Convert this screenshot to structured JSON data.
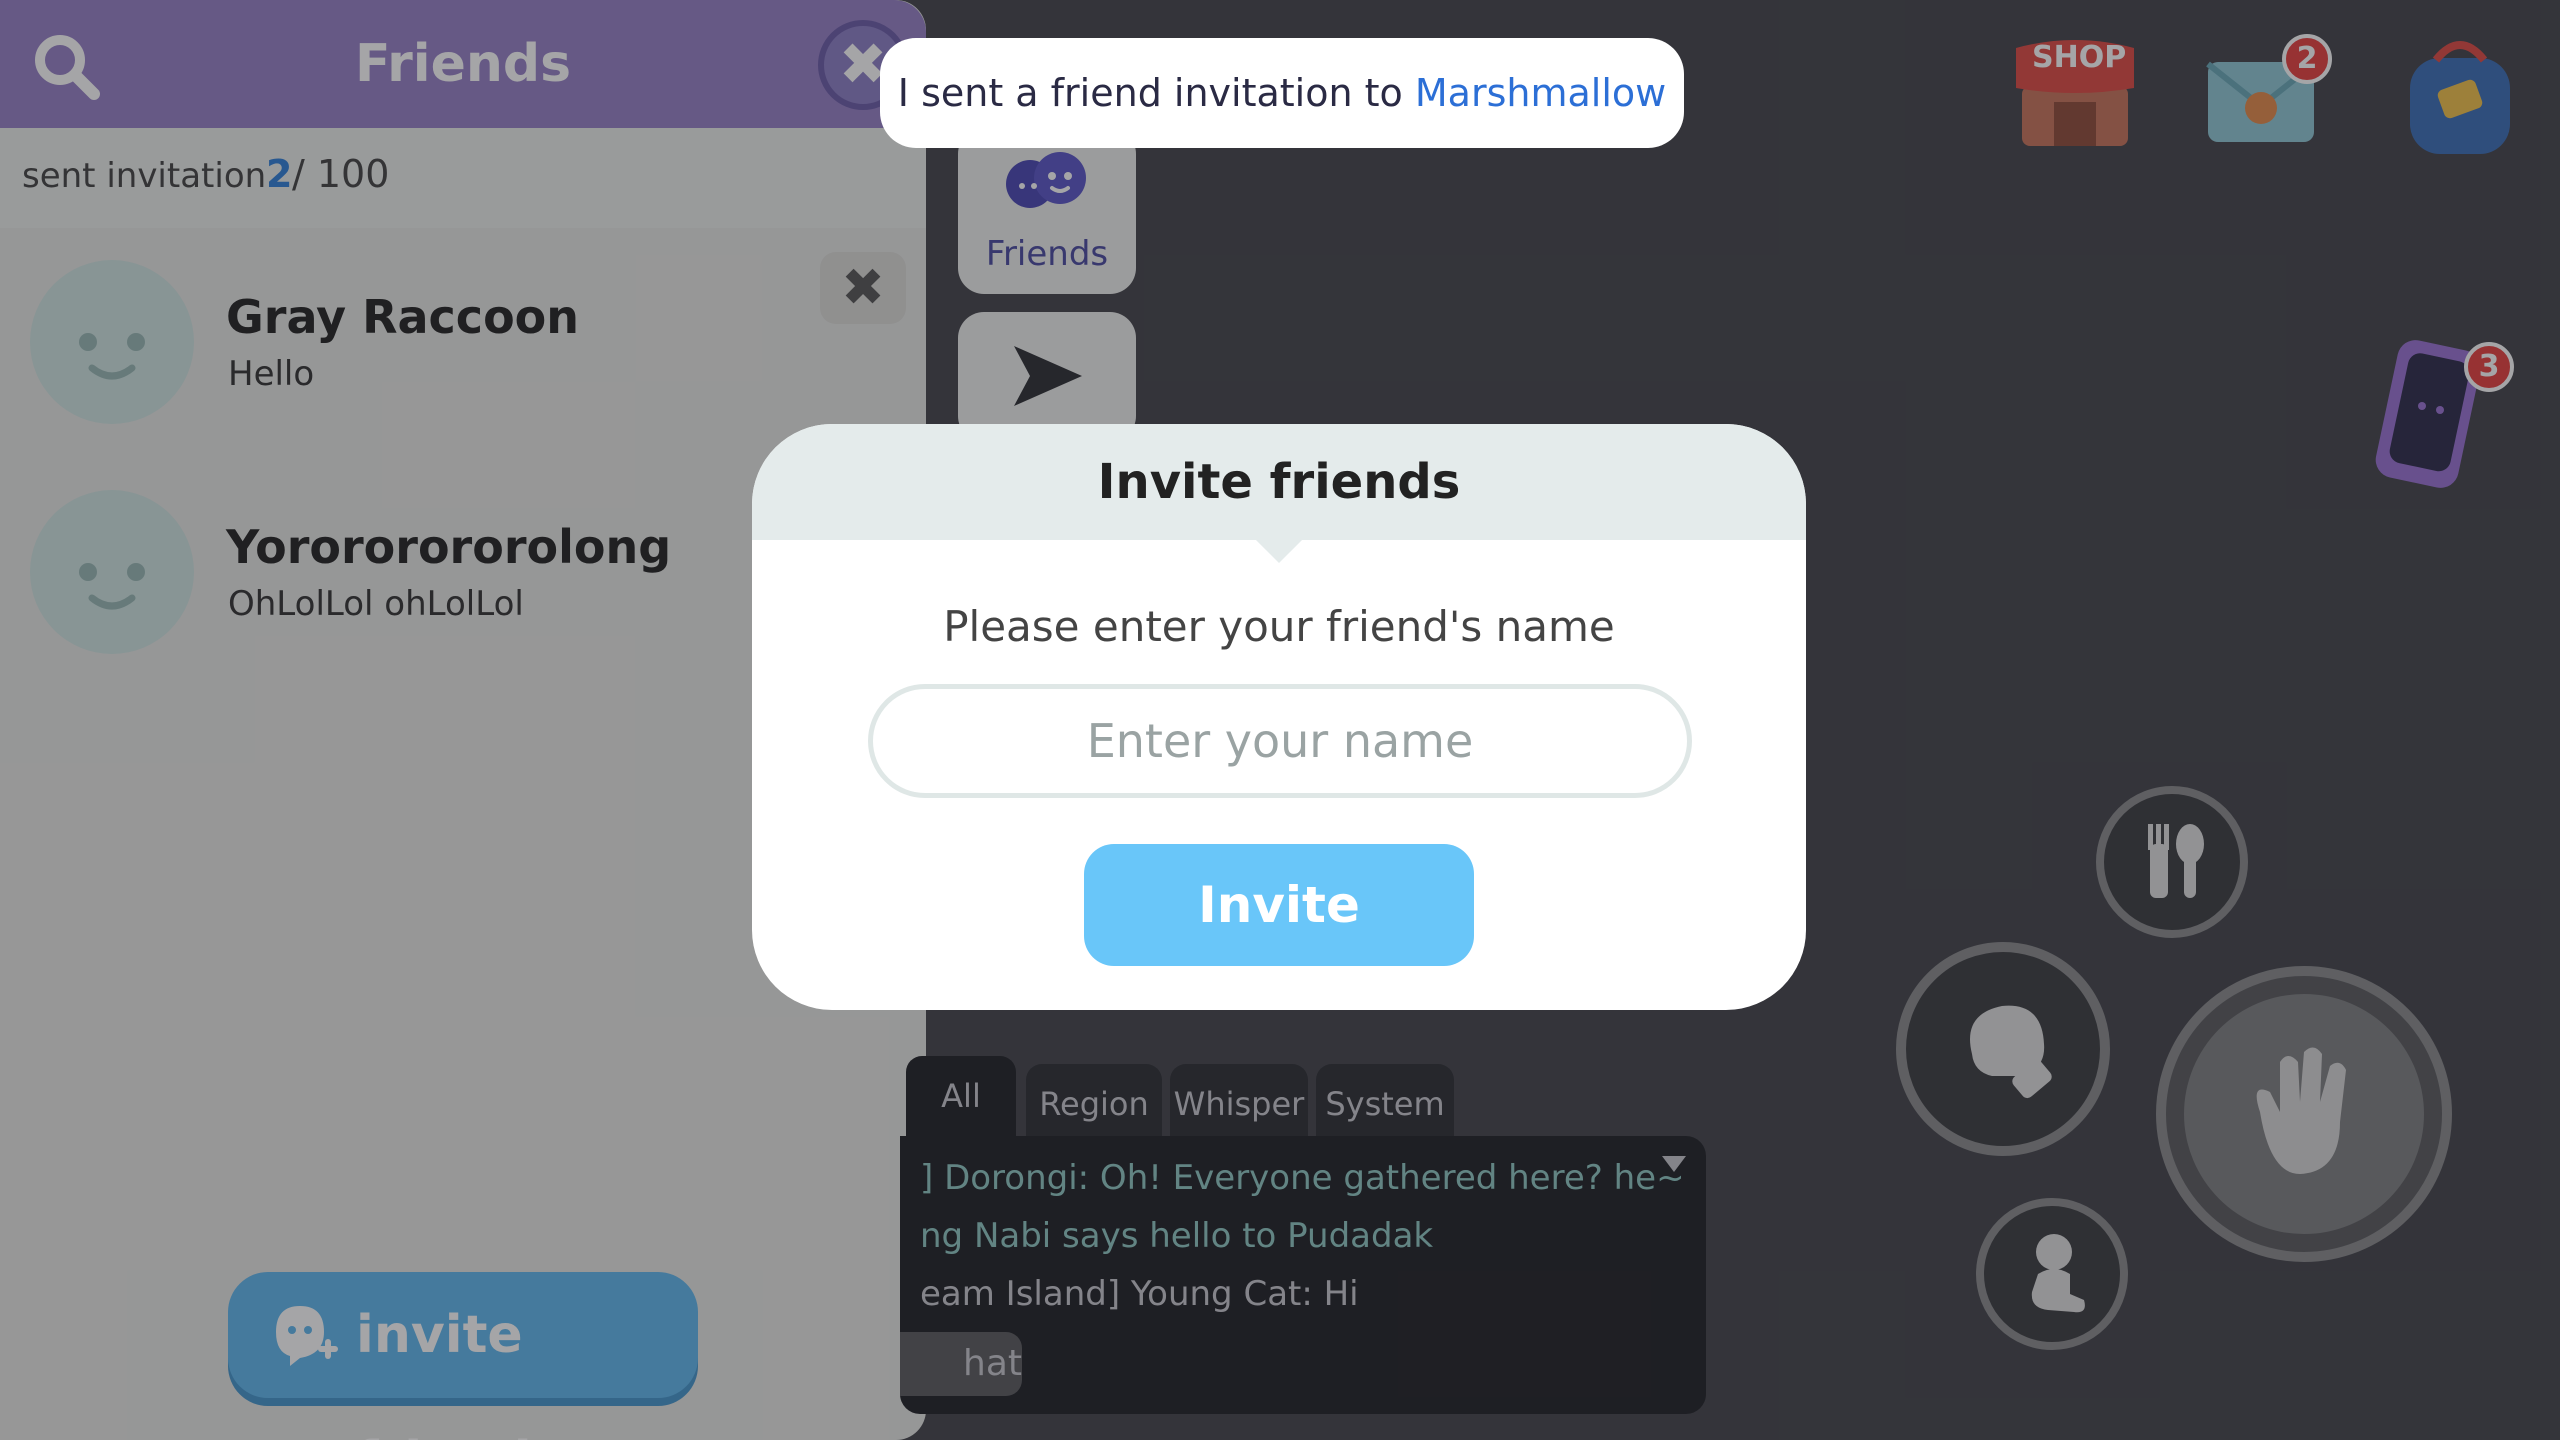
{
  "friends_panel": {
    "title": "Friends",
    "sent_invitation_label": "sent invitation",
    "sent_count": "2",
    "sent_total": "/ 100",
    "friends": [
      {
        "name": "Gray Raccoon",
        "message": "Hello"
      },
      {
        "name": "Yorororororolong",
        "message": "OhLolLol ohLolLol"
      }
    ],
    "invite_friends_label": "invite friends"
  },
  "side_tabs": {
    "friends_label": "Friends"
  },
  "toast": {
    "prefix": "I sent a friend invitation to ",
    "name": "Marshmallow"
  },
  "hud": {
    "shop_label": "SHOP",
    "mail_badge": "2",
    "phone_badge": "3"
  },
  "invite_dialog": {
    "title": "Invite friends",
    "prompt": "Please enter your friend's name",
    "input_placeholder": "Enter your name",
    "input_value": "",
    "invite_label": "Invite"
  },
  "chat": {
    "tabs": [
      "All",
      "Region",
      "Whisper",
      "System"
    ],
    "lines": [
      {
        "text": "] Dorongi: Oh! Everyone gathered here? he~",
        "color": "#8fc9c4"
      },
      {
        "text": "ng Nabi says hello to Pudadak",
        "color": "#8fc9c4"
      },
      {
        "text": "eam Island] Young Cat: Hi",
        "color": "#c9c9cf"
      }
    ],
    "chat_button_label": "hat"
  },
  "colors": {
    "header_purple": "#9680c7",
    "invite_blue": "#69c6f9",
    "toast_highlight": "#2c6fd6"
  }
}
